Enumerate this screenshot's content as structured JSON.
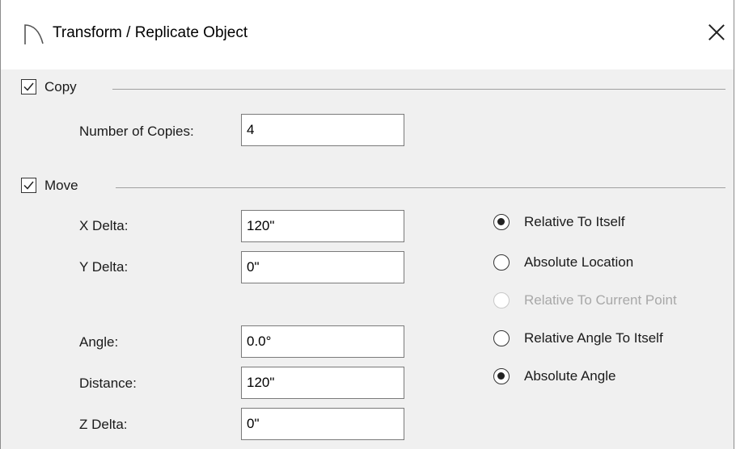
{
  "window": {
    "title": "Transform / Replicate Object",
    "icon": "arc-icon",
    "close": "close-icon"
  },
  "copy": {
    "label": "Copy",
    "checked": true,
    "copies_label": "Number of Copies:",
    "copies_value": "4"
  },
  "move": {
    "label": "Move",
    "checked": true,
    "fields": [
      {
        "label": "X Delta:",
        "value": "120\""
      },
      {
        "label": "Y Delta:",
        "value": "0\""
      },
      {
        "label": "Angle:",
        "value": "0.0°"
      },
      {
        "label": "Distance:",
        "value": "120\""
      },
      {
        "label": "Z Delta:",
        "value": "0\""
      }
    ],
    "options": [
      {
        "label": "Relative To Itself",
        "selected": true,
        "enabled": true
      },
      {
        "label": "Absolute Location",
        "selected": false,
        "enabled": true
      },
      {
        "label": "Relative To Current Point",
        "selected": false,
        "enabled": false
      },
      {
        "label": "Relative Angle To Itself",
        "selected": false,
        "enabled": true
      },
      {
        "label": "Absolute Angle",
        "selected": true,
        "enabled": true
      }
    ]
  }
}
